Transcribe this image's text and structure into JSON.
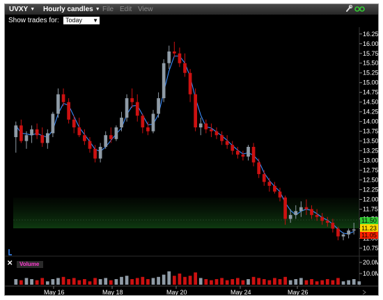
{
  "titlebar": {
    "symbol": "UVXY",
    "chart_type": "Hourly candles",
    "menus": [
      "File",
      "Edit",
      "View"
    ]
  },
  "toolbar": {
    "trades_label": "Show trades for:",
    "trades_value": "Today"
  },
  "volume_label": "Volume",
  "colors": {
    "up": "#8f9ba6",
    "down": "#cc1111",
    "ma": "#3a8dff",
    "bg": "#000000",
    "bid": "#33cc33",
    "last": "#ffd800",
    "ask": "#ff2200"
  },
  "price_tags": {
    "top": "11.50",
    "mid": "11.23",
    "bottom": "11.05"
  },
  "chart_data": {
    "type": "candlestick",
    "x_labels": [
      "May 16",
      "May 18",
      "May 20",
      "May 24",
      "May 26"
    ],
    "price_ticks": [
      "16.25",
      "16.00",
      "15.75",
      "15.50",
      "15.25",
      "15.00",
      "14.75",
      "14.50",
      "14.25",
      "14.00",
      "13.75",
      "13.50",
      "13.25",
      "13.00",
      "12.75",
      "12.50",
      "12.25",
      "12.00",
      "11.75",
      "11.50",
      "11.25",
      "11.00",
      "10.75"
    ],
    "volume_ticks": [
      "20.0M",
      "10.0M"
    ],
    "ylim": [
      10.65,
      16.3
    ],
    "volume_max": 20.0,
    "candles": [
      {
        "o": 13.6,
        "h": 14.0,
        "l": 13.2,
        "c": 13.9
      },
      {
        "o": 13.9,
        "h": 14.05,
        "l": 13.45,
        "c": 13.5
      },
      {
        "o": 13.5,
        "h": 13.75,
        "l": 13.3,
        "c": 13.65
      },
      {
        "o": 13.65,
        "h": 13.9,
        "l": 13.45,
        "c": 13.8
      },
      {
        "o": 13.8,
        "h": 13.95,
        "l": 13.55,
        "c": 13.65
      },
      {
        "o": 13.65,
        "h": 13.85,
        "l": 13.35,
        "c": 13.45
      },
      {
        "o": 13.45,
        "h": 13.8,
        "l": 13.3,
        "c": 13.7
      },
      {
        "o": 13.7,
        "h": 14.25,
        "l": 13.6,
        "c": 14.2
      },
      {
        "o": 14.2,
        "h": 14.85,
        "l": 14.1,
        "c": 14.7
      },
      {
        "o": 14.7,
        "h": 14.85,
        "l": 14.4,
        "c": 14.5
      },
      {
        "o": 14.5,
        "h": 14.6,
        "l": 13.95,
        "c": 14.05
      },
      {
        "o": 14.05,
        "h": 14.15,
        "l": 13.7,
        "c": 13.85
      },
      {
        "o": 13.85,
        "h": 14.1,
        "l": 13.6,
        "c": 13.65
      },
      {
        "o": 13.65,
        "h": 13.8,
        "l": 13.4,
        "c": 13.5
      },
      {
        "o": 13.5,
        "h": 13.6,
        "l": 13.2,
        "c": 13.3
      },
      {
        "o": 13.3,
        "h": 13.4,
        "l": 12.95,
        "c": 13.05
      },
      {
        "o": 13.05,
        "h": 13.45,
        "l": 12.95,
        "c": 13.35
      },
      {
        "o": 13.35,
        "h": 13.75,
        "l": 13.3,
        "c": 13.65
      },
      {
        "o": 13.65,
        "h": 13.85,
        "l": 13.45,
        "c": 13.55
      },
      {
        "o": 13.55,
        "h": 13.9,
        "l": 13.5,
        "c": 13.85
      },
      {
        "o": 13.85,
        "h": 14.25,
        "l": 13.75,
        "c": 14.1
      },
      {
        "o": 14.1,
        "h": 14.7,
        "l": 14.0,
        "c": 14.6
      },
      {
        "o": 14.6,
        "h": 14.85,
        "l": 14.35,
        "c": 14.5
      },
      {
        "o": 14.5,
        "h": 14.7,
        "l": 14.0,
        "c": 14.15
      },
      {
        "o": 14.15,
        "h": 14.2,
        "l": 13.7,
        "c": 13.85
      },
      {
        "o": 13.85,
        "h": 14.0,
        "l": 13.65,
        "c": 13.75
      },
      {
        "o": 13.75,
        "h": 14.3,
        "l": 13.7,
        "c": 14.2
      },
      {
        "o": 14.2,
        "h": 14.75,
        "l": 14.1,
        "c": 14.6
      },
      {
        "o": 14.6,
        "h": 15.6,
        "l": 14.5,
        "c": 15.5
      },
      {
        "o": 15.5,
        "h": 15.95,
        "l": 15.35,
        "c": 15.8
      },
      {
        "o": 15.8,
        "h": 16.05,
        "l": 15.65,
        "c": 15.75
      },
      {
        "o": 15.75,
        "h": 15.9,
        "l": 15.4,
        "c": 15.5
      },
      {
        "o": 15.5,
        "h": 15.75,
        "l": 15.15,
        "c": 15.25
      },
      {
        "o": 15.25,
        "h": 15.35,
        "l": 14.5,
        "c": 14.7
      },
      {
        "o": 14.7,
        "h": 14.85,
        "l": 13.75,
        "c": 13.85
      },
      {
        "o": 13.85,
        "h": 14.1,
        "l": 13.65,
        "c": 13.95
      },
      {
        "o": 13.95,
        "h": 14.05,
        "l": 13.7,
        "c": 13.8
      },
      {
        "o": 13.8,
        "h": 13.95,
        "l": 13.6,
        "c": 13.75
      },
      {
        "o": 13.75,
        "h": 13.85,
        "l": 13.55,
        "c": 13.65
      },
      {
        "o": 13.65,
        "h": 13.75,
        "l": 13.4,
        "c": 13.5
      },
      {
        "o": 13.5,
        "h": 13.65,
        "l": 13.3,
        "c": 13.4
      },
      {
        "o": 13.4,
        "h": 13.5,
        "l": 13.15,
        "c": 13.25
      },
      {
        "o": 13.25,
        "h": 13.35,
        "l": 13.05,
        "c": 13.15
      },
      {
        "o": 13.15,
        "h": 13.25,
        "l": 13.0,
        "c": 13.1
      },
      {
        "o": 13.1,
        "h": 13.4,
        "l": 13.0,
        "c": 13.35
      },
      {
        "o": 13.35,
        "h": 13.45,
        "l": 12.85,
        "c": 12.95
      },
      {
        "o": 12.95,
        "h": 13.05,
        "l": 12.55,
        "c": 12.65
      },
      {
        "o": 12.65,
        "h": 12.75,
        "l": 12.35,
        "c": 12.45
      },
      {
        "o": 12.45,
        "h": 12.55,
        "l": 12.2,
        "c": 12.35
      },
      {
        "o": 12.35,
        "h": 12.45,
        "l": 12.15,
        "c": 12.2
      },
      {
        "o": 12.2,
        "h": 12.3,
        "l": 11.95,
        "c": 12.05
      },
      {
        "o": 12.05,
        "h": 12.1,
        "l": 11.35,
        "c": 11.5
      },
      {
        "o": 11.5,
        "h": 11.75,
        "l": 11.4,
        "c": 11.6
      },
      {
        "o": 11.6,
        "h": 11.85,
        "l": 11.5,
        "c": 11.7
      },
      {
        "o": 11.7,
        "h": 11.95,
        "l": 11.55,
        "c": 11.8
      },
      {
        "o": 11.8,
        "h": 12.0,
        "l": 11.6,
        "c": 11.75
      },
      {
        "o": 11.75,
        "h": 11.85,
        "l": 11.5,
        "c": 11.6
      },
      {
        "o": 11.6,
        "h": 11.75,
        "l": 11.45,
        "c": 11.55
      },
      {
        "o": 11.55,
        "h": 11.65,
        "l": 11.35,
        "c": 11.45
      },
      {
        "o": 11.45,
        "h": 11.55,
        "l": 11.3,
        "c": 11.4
      },
      {
        "o": 11.4,
        "h": 11.5,
        "l": 11.15,
        "c": 11.25
      },
      {
        "o": 11.25,
        "h": 11.3,
        "l": 10.95,
        "c": 11.05
      },
      {
        "o": 11.05,
        "h": 11.15,
        "l": 10.95,
        "c": 11.1
      },
      {
        "o": 11.1,
        "h": 11.25,
        "l": 11.0,
        "c": 11.2
      },
      {
        "o": 11.2,
        "h": 11.4,
        "l": 11.1,
        "c": 11.23
      }
    ],
    "volumes": [
      5,
      4,
      6,
      5,
      4,
      6,
      3,
      5,
      6,
      7,
      5,
      6,
      4,
      5,
      3,
      6,
      5,
      6,
      4,
      5,
      7,
      8,
      5,
      6,
      7,
      5,
      6,
      7,
      9,
      12,
      8,
      10,
      7,
      8,
      11,
      6,
      5,
      4,
      5,
      6,
      4,
      5,
      6,
      4,
      5,
      7,
      6,
      5,
      4,
      6,
      5,
      7,
      4,
      5,
      6,
      4,
      5,
      3,
      4,
      5,
      4,
      6,
      3,
      4,
      5,
      3
    ]
  }
}
